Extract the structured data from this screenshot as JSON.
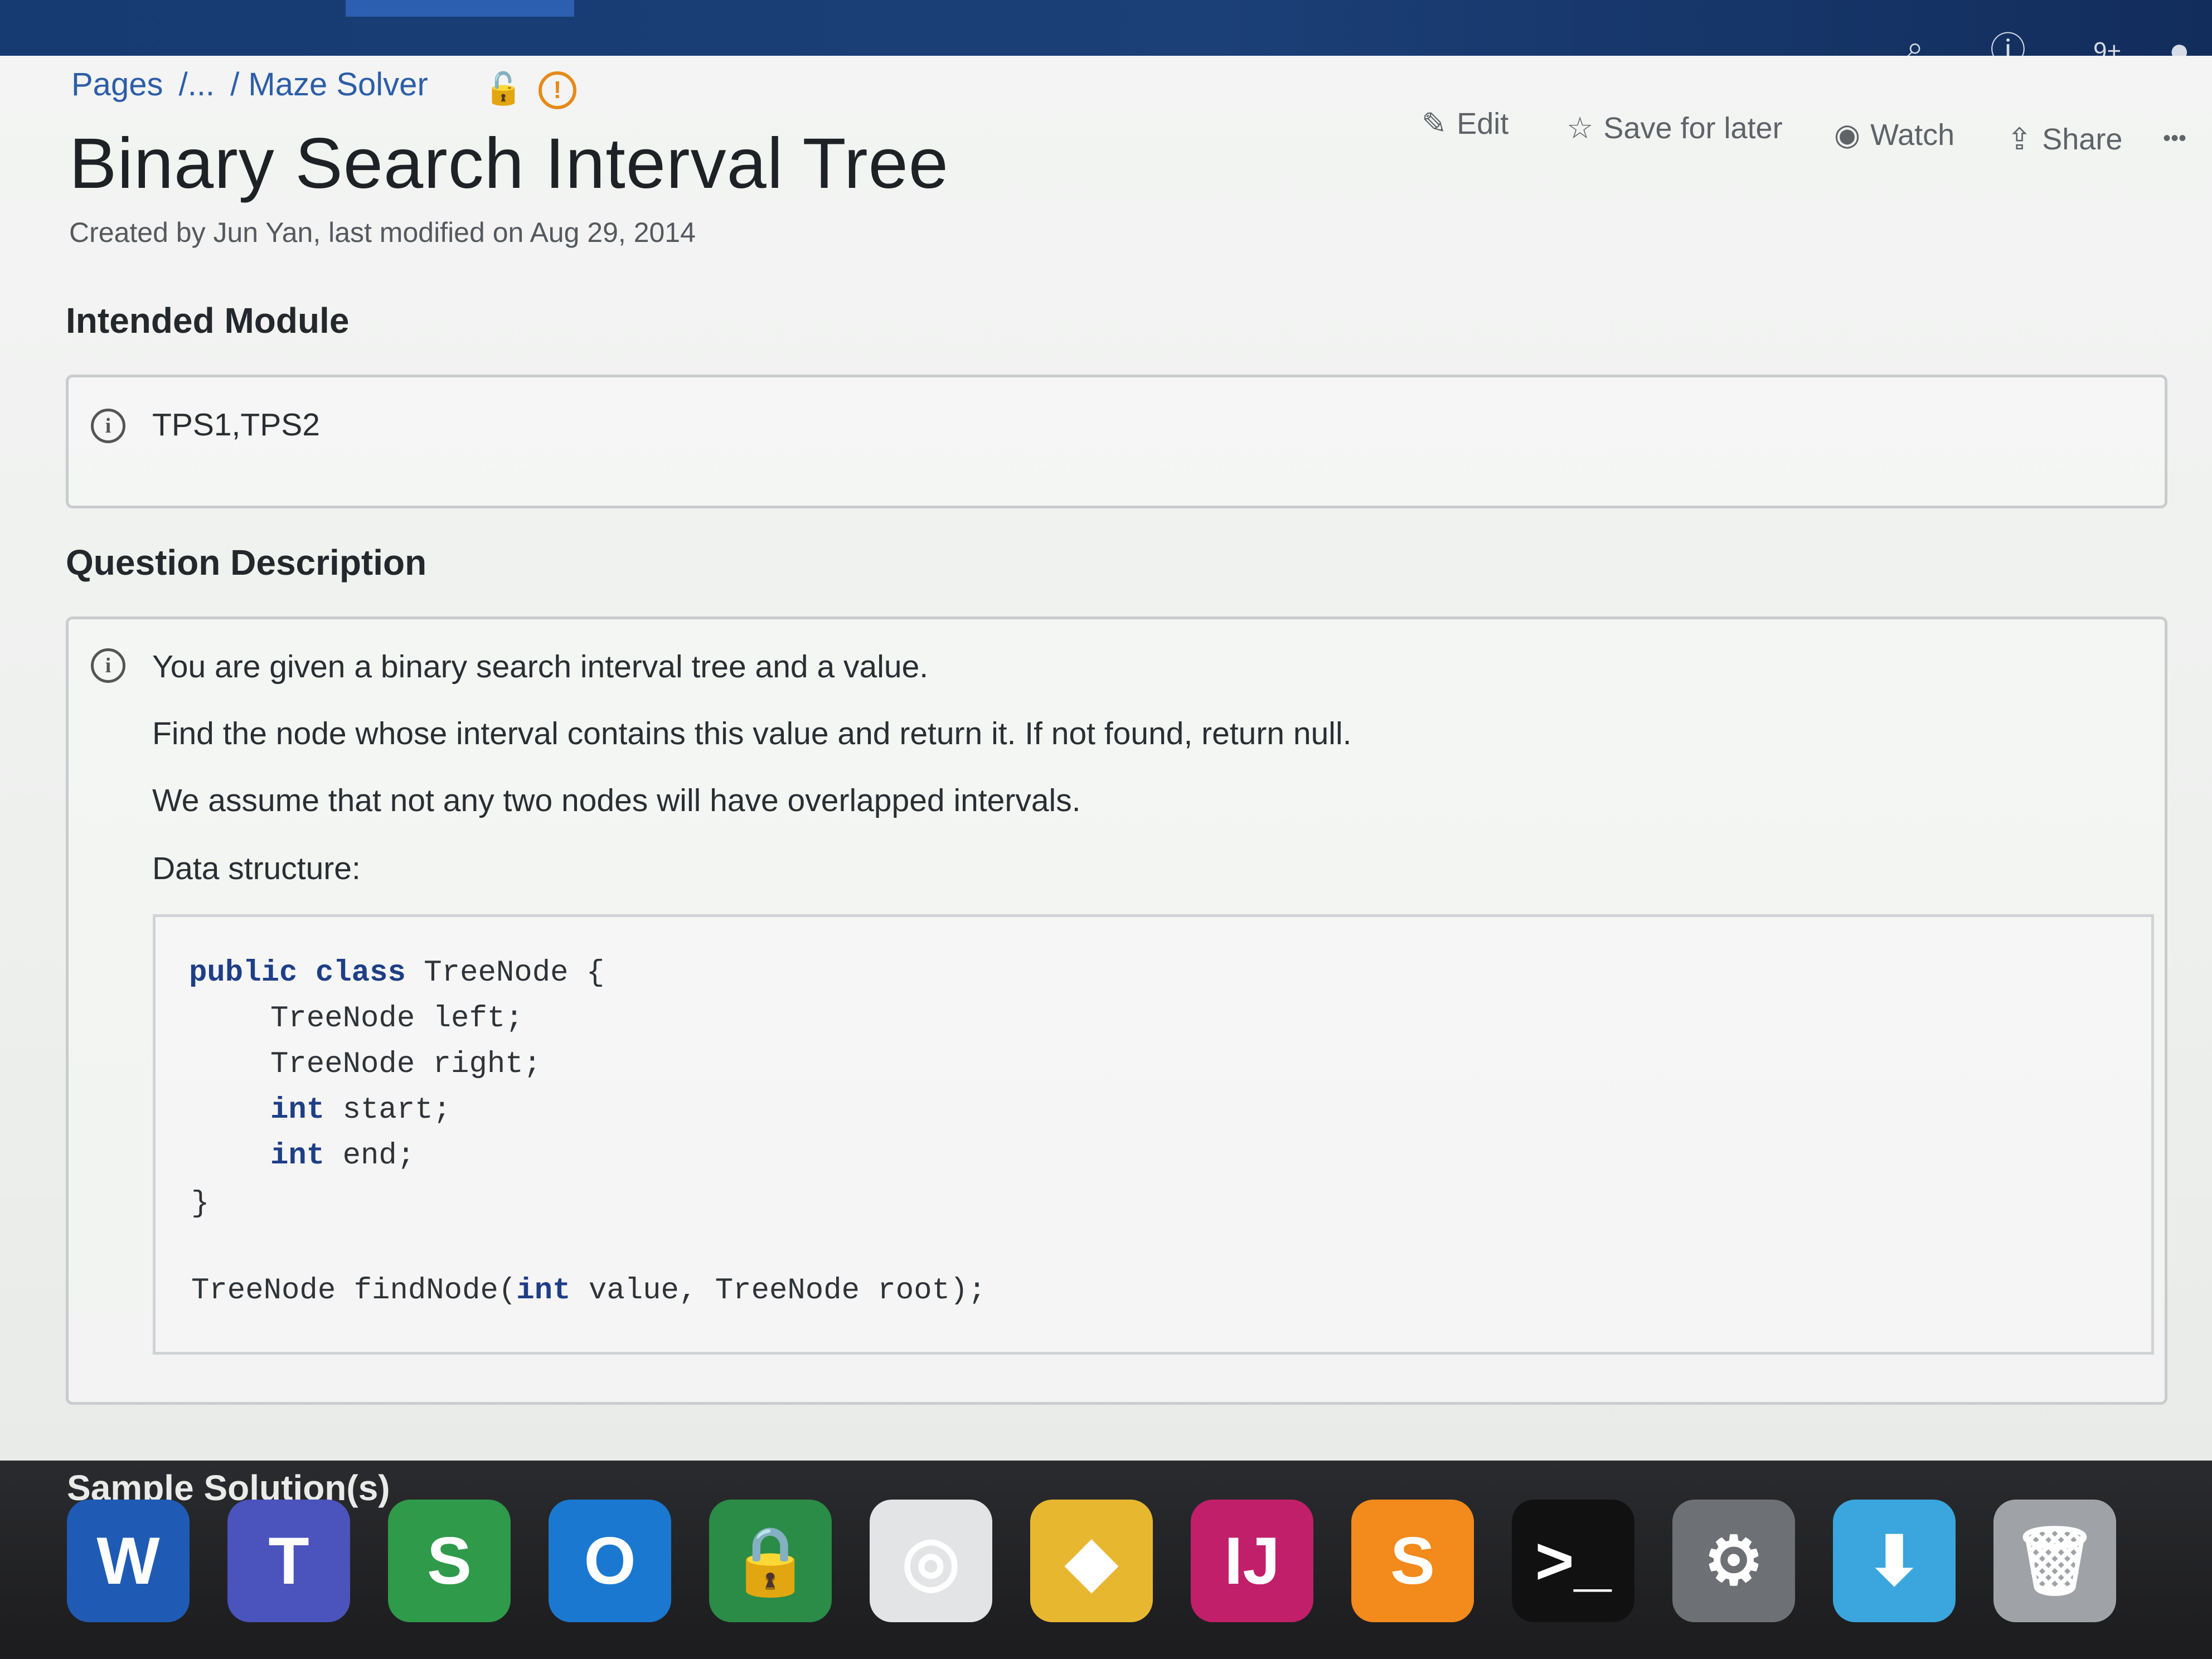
{
  "breadcrumb": {
    "pages": "Pages",
    "ellipsis": "/...",
    "current": "/ Maze Solver"
  },
  "title": "Binary Search Interval Tree",
  "meta": "Created by Jun Yan, last modified on Aug 29, 2014",
  "actions": {
    "edit": "Edit",
    "save": "Save for later",
    "watch": "Watch",
    "share": "Share",
    "more": "•••"
  },
  "topbar": {
    "notifications": "9+"
  },
  "intended_module": {
    "heading": "Intended Module",
    "value": "TPS1,TPS2"
  },
  "question": {
    "heading": "Question Description",
    "lines": [
      "You are given a binary search interval tree and a value.",
      "Find the node whose interval contains this value and return it. If not found, return null.",
      "We assume that not any two nodes will have overlapped intervals.",
      "Data structure:"
    ]
  },
  "code": {
    "line1_kw": "public class",
    "line1_rest": " TreeNode {",
    "line2": "TreeNode left;",
    "line3": "TreeNode right;",
    "line4_kw": "int",
    "line4_rest": " start;",
    "line5_kw": "int",
    "line5_rest": " end;",
    "line6": "}",
    "line7_a": "TreeNode findNode(",
    "line7_kw": "int",
    "line7_b": " value, TreeNode root);"
  },
  "next_heading": "Sample Solution(s)",
  "dock": {
    "apps": [
      {
        "name": "Word",
        "glyph": "W",
        "color": "#1f5bb5"
      },
      {
        "name": "Teams",
        "glyph": "T",
        "color": "#4b53bc"
      },
      {
        "name": "Slack-like",
        "glyph": "S",
        "color": "#2e9a4a"
      },
      {
        "name": "Outlook",
        "glyph": "O",
        "color": "#1b78d0"
      },
      {
        "name": "VPN",
        "glyph": "🔒",
        "color": "#2a8c46"
      },
      {
        "name": "Wireless",
        "glyph": "◎",
        "color": "#e2e4e6"
      },
      {
        "name": "App",
        "glyph": "◆",
        "color": "#e8b730"
      },
      {
        "name": "IntelliJ",
        "glyph": "IJ",
        "color": "#c21f6b"
      },
      {
        "name": "Sublime",
        "glyph": "S",
        "color": "#f28a1c"
      },
      {
        "name": "Terminal",
        "glyph": ">_",
        "color": "#111111"
      },
      {
        "name": "Settings",
        "glyph": "⚙",
        "color": "#6d7075"
      },
      {
        "name": "Folder",
        "glyph": "⬇",
        "color": "#3ba6dd"
      },
      {
        "name": "Trash",
        "glyph": "🗑",
        "color": "#9fa3a8"
      }
    ]
  }
}
